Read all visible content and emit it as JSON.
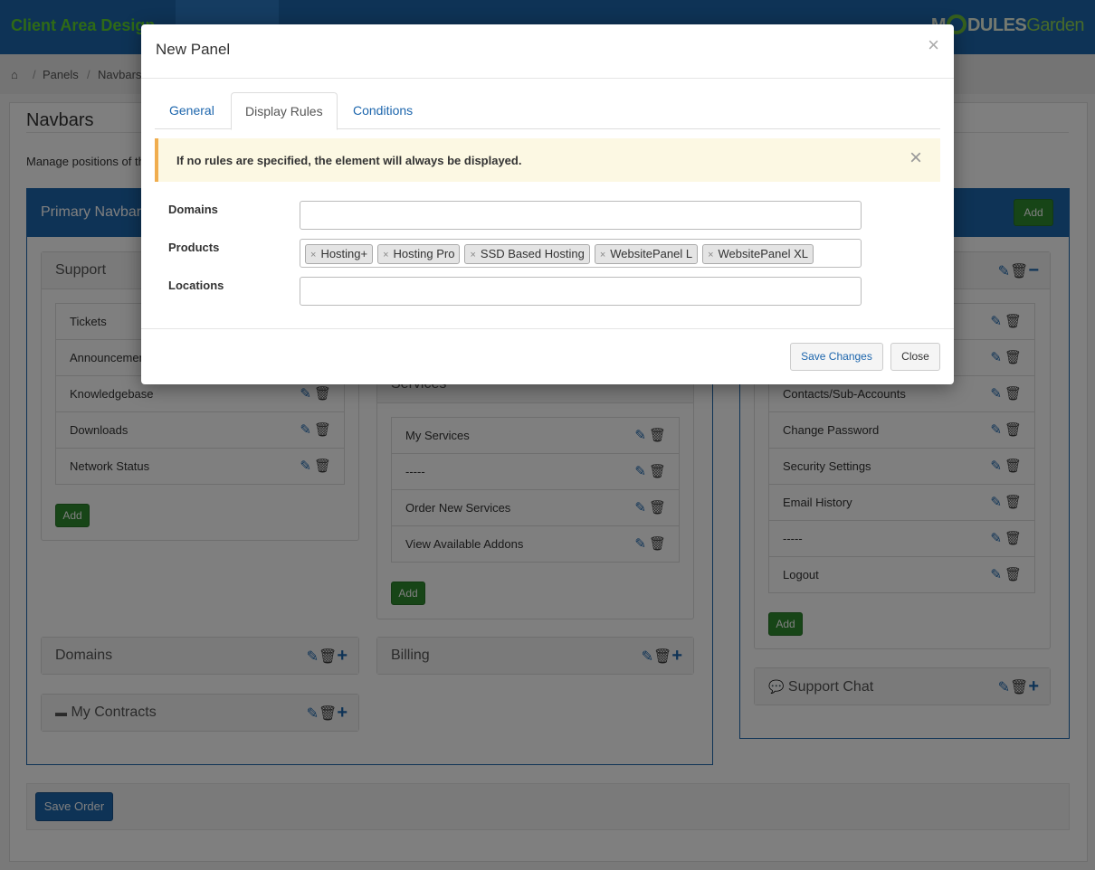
{
  "app": {
    "brand": "Client Area Design",
    "logo_main": "M",
    "logo_rest": "DULES",
    "logo_garden": "Garden"
  },
  "breadcrumb": [
    "Panels",
    "Navbars"
  ],
  "page": {
    "title": "Navbars",
    "description": "Manage positions of the"
  },
  "primary_navbar": {
    "title": "Primary Navbar",
    "add_label": "Add",
    "support": {
      "title": "Support",
      "items": [
        "Tickets",
        "Announcements",
        "Knowledgebase",
        "Downloads",
        "Network Status"
      ],
      "add_label": "Add"
    },
    "services": {
      "title": "Services",
      "items": [
        "My Services",
        "-----",
        "Order New Services",
        "View Available Addons"
      ],
      "add_label": "Add"
    },
    "domains_title": "Domains",
    "billing_title": "Billing",
    "contracts_title": "My Contracts"
  },
  "secondary_navbar": {
    "add_label": "Add",
    "account": {
      "items": [
        "",
        "",
        "Contacts/Sub-Accounts",
        "Change Password",
        "Security Settings",
        "Email History",
        "-----",
        "Logout"
      ],
      "add_label": "Add"
    },
    "support_chat_title": "Support Chat"
  },
  "save_order_label": "Save Order",
  "modal": {
    "title": "New Panel",
    "tabs": [
      "General",
      "Display Rules",
      "Conditions"
    ],
    "alert": "If no rules are specified, the element will always be displayed.",
    "fields": {
      "domains_label": "Domains",
      "products_label": "Products",
      "locations_label": "Locations"
    },
    "products": [
      "Hosting+",
      "Hosting Pro",
      "SSD Based Hosting",
      "WebsitePanel L",
      "WebsitePanel XL"
    ],
    "save_label": "Save Changes",
    "close_label": "Close"
  },
  "colors": {
    "primary": "#1d66ad",
    "success": "#2e8b2e",
    "alert_bg": "#fcf8e3",
    "alert_border": "#f0ad4e"
  }
}
